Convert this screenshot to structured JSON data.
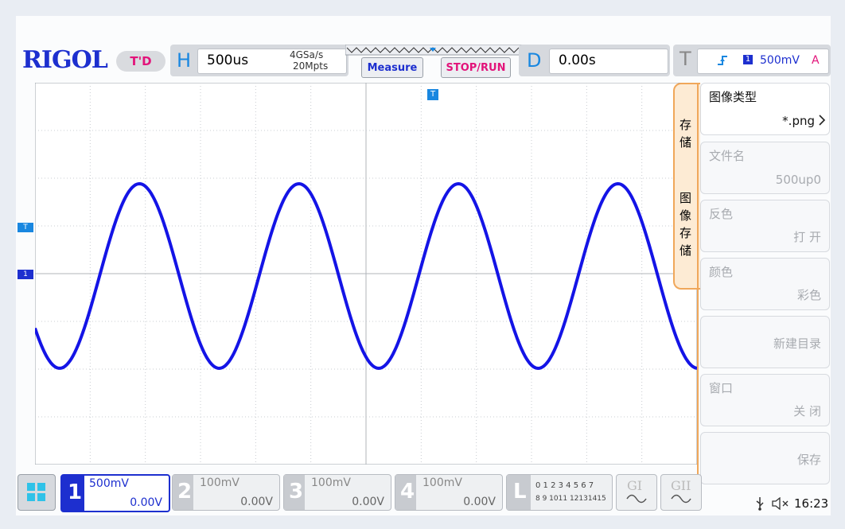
{
  "header": {
    "brand": "RIGOL",
    "status": "T'D",
    "horizontal": {
      "label": "H",
      "timebase": "500us",
      "sample_rate": "4GSa/s",
      "memory_depth": "20Mpts"
    },
    "measure_button": "Measure",
    "stop_run_button": "STOP/RUN",
    "delay": {
      "label": "D",
      "value": "0.00s"
    },
    "trigger": {
      "label": "T",
      "source": "1",
      "level": "500mV",
      "mode": "A"
    }
  },
  "side_tabs": {
    "storage": "存储",
    "image_storage": "图像存储"
  },
  "menu": [
    {
      "title": "图像类型",
      "value": "*.png",
      "enabled": true
    },
    {
      "title": "文件名",
      "value": "500up0",
      "enabled": false
    },
    {
      "title": "反色",
      "value": "打 开",
      "enabled": false
    },
    {
      "title": "颜色",
      "value": "彩色",
      "enabled": false
    },
    {
      "title": "",
      "value": "新建目录",
      "enabled": false
    },
    {
      "title": "窗口",
      "value": "关 闭",
      "enabled": false
    },
    {
      "title": "",
      "value": "保存",
      "enabled": false
    }
  ],
  "markers": {
    "trigger_marker": "T",
    "channel_marker": "1",
    "top_trigger": "T"
  },
  "channels": [
    {
      "num": "1",
      "scale": "500mV",
      "offset": "0.00V",
      "active": true
    },
    {
      "num": "2",
      "scale": "100mV",
      "offset": "0.00V",
      "active": false
    },
    {
      "num": "3",
      "scale": "100mV",
      "offset": "0.00V",
      "active": false
    },
    {
      "num": "4",
      "scale": "100mV",
      "offset": "0.00V",
      "active": false
    }
  ],
  "logic": {
    "label": "L",
    "row1": "0 1 2 3   4 5 6 7",
    "row2": "8 9 1011 12131415"
  },
  "gen1": "GI",
  "gen2": "GII",
  "status_bar": {
    "time": "16:23"
  },
  "waveform": {
    "color": "#1414e6",
    "cycles": 4,
    "grid": "12x8"
  }
}
